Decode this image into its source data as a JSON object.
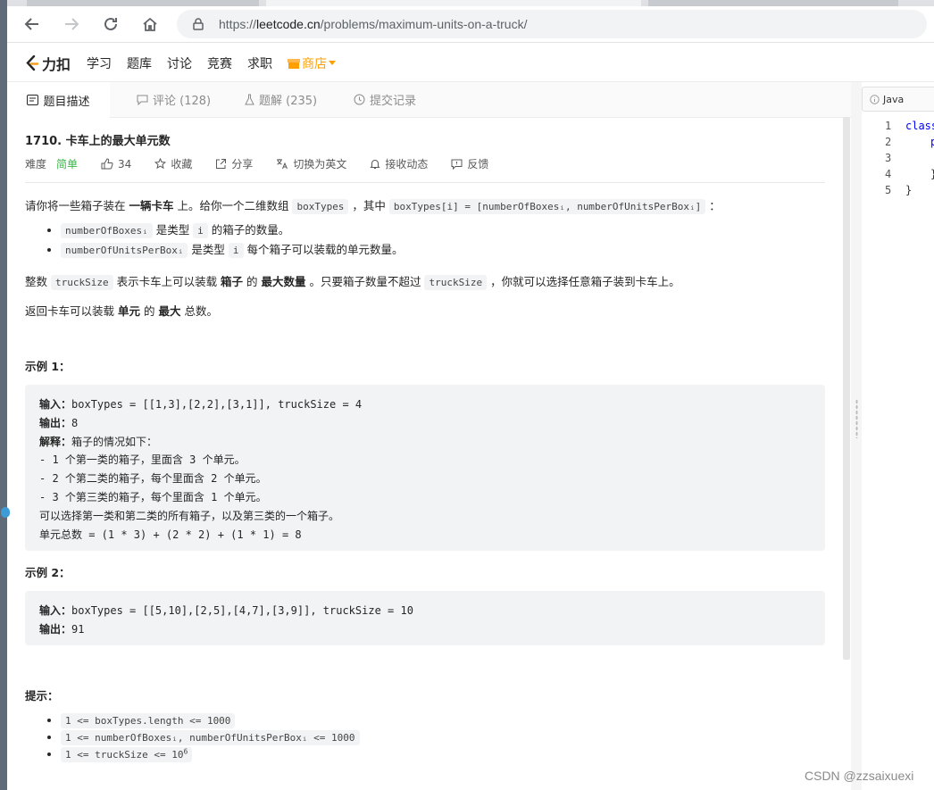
{
  "browser": {
    "url_prefix": "https://",
    "url_domain": "leetcode.cn",
    "url_path": "/problems/maximum-units-on-a-truck/"
  },
  "site": {
    "logo": "力扣",
    "nav": [
      "学习",
      "题库",
      "讨论",
      "竞赛",
      "求职"
    ],
    "shop": "商店"
  },
  "tabs": [
    {
      "label": "题目描述"
    },
    {
      "label": "评论 (128)"
    },
    {
      "label": "题解 (235)"
    },
    {
      "label": "提交记录"
    }
  ],
  "editor": {
    "language": "Java",
    "line_numbers": [
      "1",
      "2",
      "3",
      "4",
      "5"
    ],
    "lines": [
      "class",
      "p",
      "",
      "}",
      "}"
    ]
  },
  "problem": {
    "title": "1710. 卡车上的最大单元数",
    "difficulty_label": "难度",
    "difficulty": "简单",
    "likes": "34",
    "actions": [
      "收藏",
      "分享",
      "切换为英文",
      "接收动态",
      "反馈"
    ],
    "para1": {
      "a": "请你将一些箱子装在 ",
      "b": "一辆卡车",
      "c": " 上。给你一个二维数组 ",
      "code1": "boxTypes",
      "d": " ，其中 ",
      "code2": "boxTypes[i] = [numberOfBoxesᵢ, numberOfUnitsPerBoxᵢ]",
      "e": " ："
    },
    "bullets": [
      {
        "code": "numberOfBoxesᵢ",
        "a": " 是类型 ",
        "code2": "i",
        "b": " 的箱子的数量。"
      },
      {
        "code": "numberOfUnitsPerBoxᵢ",
        "a": " 是类型 ",
        "code2": "i",
        "b": " 每个箱子可以装载的单元数量。"
      }
    ],
    "para2": {
      "a": "整数 ",
      "code": "truckSize",
      "b": " 表示卡车上可以装载 ",
      "c": "箱子",
      "d": " 的 ",
      "e": "最大数量",
      "f": " 。只要箱子数量不超过 ",
      "code2": "truckSize",
      "g": " ，你就可以选择任意箱子装到卡车上。"
    },
    "para3": {
      "a": "返回卡车可以装载 ",
      "b": "单元",
      "c": " 的 ",
      "d": "最大",
      "e": " 总数。"
    },
    "example1": {
      "title": "示例 1：",
      "input_label": "输入：",
      "input": "boxTypes = [[1,3],[2,2],[3,1]], truckSize = 4",
      "output_label": "输出：",
      "output": "8",
      "explain_label": "解释：",
      "explain": "箱子的情况如下：",
      "lines": [
        "- 1 个第一类的箱子，里面含 3 个单元。",
        "- 2 个第二类的箱子，每个里面含 2 个单元。",
        "- 3 个第三类的箱子，每个里面含 1 个单元。",
        "可以选择第一类和第二类的所有箱子，以及第三类的一个箱子。",
        "单元总数 = (1 * 3) + (2 * 2) + (1 * 1) = 8"
      ]
    },
    "example2": {
      "title": "示例 2：",
      "input_label": "输入：",
      "input": "boxTypes = [[5,10],[2,5],[4,7],[3,9]], truckSize = 10",
      "output_label": "输出：",
      "output": "91"
    },
    "hints_title": "提示：",
    "hints": [
      "1 <= boxTypes.length <= 1000",
      "1 <= numberOfBoxesᵢ, numberOfUnitsPerBoxᵢ <= 1000",
      "1 <= truckSize <= 10"
    ],
    "hint3_sup": "6"
  },
  "watermark": "CSDN @zzsaixuexi"
}
